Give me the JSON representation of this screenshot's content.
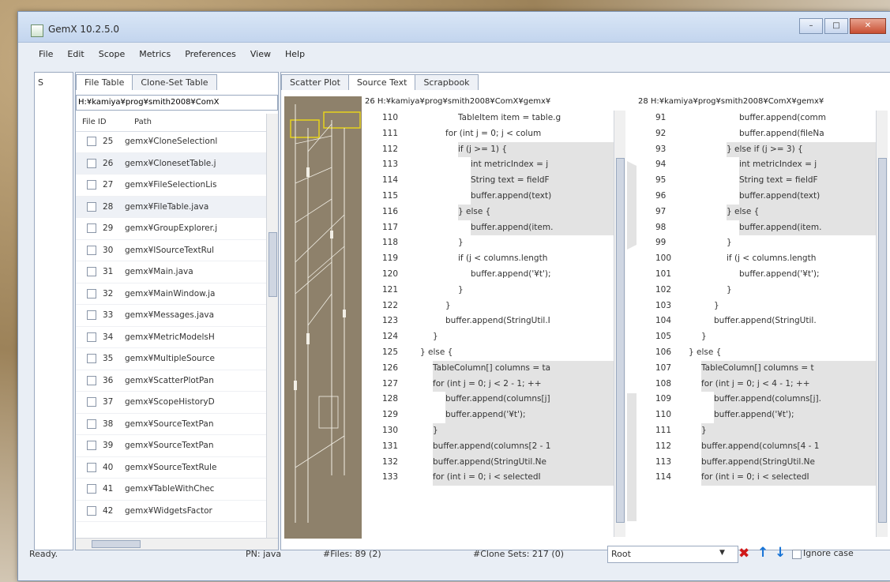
{
  "window": {
    "title": "GemX 10.2.5.0",
    "buttons": [
      "–",
      "□",
      "✕"
    ]
  },
  "menu": [
    "File",
    "Edit",
    "Scope",
    "Metrics",
    "Preferences",
    "View",
    "Help"
  ],
  "left_strip": {
    "tab": "S"
  },
  "file_panel": {
    "tabs": [
      "File Table",
      "Clone-Set Table"
    ],
    "path": "H:¥kamiya¥prog¥smith2008¥ComX",
    "columns": [
      "File ID",
      "Path"
    ],
    "rows": [
      {
        "id": "25",
        "path": "gemx¥CloneSelectionl"
      },
      {
        "id": "26",
        "path": "gemx¥ClonesetTable.j"
      },
      {
        "id": "27",
        "path": "gemx¥FileSelectionLis"
      },
      {
        "id": "28",
        "path": "gemx¥FileTable.java"
      },
      {
        "id": "29",
        "path": "gemx¥GroupExplorer.j"
      },
      {
        "id": "30",
        "path": "gemx¥ISourceTextRul"
      },
      {
        "id": "31",
        "path": "gemx¥Main.java"
      },
      {
        "id": "32",
        "path": "gemx¥MainWindow.ja"
      },
      {
        "id": "33",
        "path": "gemx¥Messages.java"
      },
      {
        "id": "34",
        "path": "gemx¥MetricModelsH"
      },
      {
        "id": "35",
        "path": "gemx¥MultipleSource"
      },
      {
        "id": "36",
        "path": "gemx¥ScatterPlotPan"
      },
      {
        "id": "37",
        "path": "gemx¥ScopeHistoryD"
      },
      {
        "id": "38",
        "path": "gemx¥SourceTextPan"
      },
      {
        "id": "39",
        "path": "gemx¥SourceTextPan"
      },
      {
        "id": "40",
        "path": "gemx¥SourceTextRule"
      },
      {
        "id": "41",
        "path": "gemx¥TableWithChec"
      },
      {
        "id": "42",
        "path": "gemx¥WidgetsFactor"
      }
    ]
  },
  "right_panel": {
    "tabs": [
      "Scatter Plot",
      "Source Text",
      "Scrapbook"
    ],
    "left_header": "26 H:¥kamiya¥prog¥smith2008¥ComX¥gemx¥",
    "right_header": "28 H:¥kamiya¥prog¥smith2008¥ComX¥gemx¥",
    "left_lines": [
      {
        "n": "110",
        "indent": 4,
        "hl": false,
        "code": "TableItem item = table.g"
      },
      {
        "n": "111",
        "indent": 3,
        "hl": false,
        "code": "for (int j = 0; j < colum"
      },
      {
        "n": "112",
        "indent": 4,
        "hl": true,
        "code": "if (j >= 1) {"
      },
      {
        "n": "113",
        "indent": 5,
        "hl": true,
        "code": "int metricIndex = j"
      },
      {
        "n": "114",
        "indent": 5,
        "hl": true,
        "code": "String text = fieldF"
      },
      {
        "n": "115",
        "indent": 5,
        "hl": true,
        "code": "buffer.append(text)"
      },
      {
        "n": "116",
        "indent": 4,
        "hl": true,
        "code": "} else {"
      },
      {
        "n": "117",
        "indent": 5,
        "hl": true,
        "code": "buffer.append(item."
      },
      {
        "n": "118",
        "indent": 4,
        "hl": false,
        "code": "}"
      },
      {
        "n": "119",
        "indent": 4,
        "hl": false,
        "code": "if (j < columns.length"
      },
      {
        "n": "120",
        "indent": 5,
        "hl": false,
        "code": "buffer.append('¥t');"
      },
      {
        "n": "121",
        "indent": 4,
        "hl": false,
        "code": "}"
      },
      {
        "n": "122",
        "indent": 3,
        "hl": false,
        "code": "}"
      },
      {
        "n": "123",
        "indent": 3,
        "hl": false,
        "code": "buffer.append(StringUtil.I"
      },
      {
        "n": "124",
        "indent": 2,
        "hl": false,
        "code": "}"
      },
      {
        "n": "125",
        "indent": 1,
        "hl": false,
        "code": "} else {"
      },
      {
        "n": "126",
        "indent": 2,
        "hl": true,
        "code": "TableColumn[] columns = ta"
      },
      {
        "n": "127",
        "indent": 2,
        "hl": true,
        "code": "for (int j = 0; j < 2 - 1; ++"
      },
      {
        "n": "128",
        "indent": 3,
        "hl": true,
        "code": "buffer.append(columns[j]"
      },
      {
        "n": "129",
        "indent": 3,
        "hl": true,
        "code": "buffer.append('¥t');"
      },
      {
        "n": "130",
        "indent": 2,
        "hl": true,
        "code": "}"
      },
      {
        "n": "131",
        "indent": 2,
        "hl": true,
        "code": "buffer.append(columns[2 - 1"
      },
      {
        "n": "132",
        "indent": 2,
        "hl": true,
        "code": "buffer.append(StringUtil.Ne"
      },
      {
        "n": "133",
        "indent": 2,
        "hl": true,
        "code": "for (int i = 0; i < selectedI"
      }
    ],
    "right_lines": [
      {
        "n": "91",
        "indent": 5,
        "hl": false,
        "code": "buffer.append(comm"
      },
      {
        "n": "92",
        "indent": 5,
        "hl": false,
        "code": "buffer.append(fileNa"
      },
      {
        "n": "93",
        "indent": 4,
        "hl": true,
        "code": "} else if (j >= 3) {"
      },
      {
        "n": "94",
        "indent": 5,
        "hl": true,
        "code": "int metricIndex = j"
      },
      {
        "n": "95",
        "indent": 5,
        "hl": true,
        "code": "String text = fieldF"
      },
      {
        "n": "96",
        "indent": 5,
        "hl": true,
        "code": "buffer.append(text)"
      },
      {
        "n": "97",
        "indent": 4,
        "hl": true,
        "code": "} else {"
      },
      {
        "n": "98",
        "indent": 5,
        "hl": true,
        "code": "buffer.append(item."
      },
      {
        "n": "99",
        "indent": 4,
        "hl": false,
        "code": "}"
      },
      {
        "n": "100",
        "indent": 4,
        "hl": false,
        "code": "if (j < columns.length"
      },
      {
        "n": "101",
        "indent": 5,
        "hl": false,
        "code": "buffer.append('¥t');"
      },
      {
        "n": "102",
        "indent": 4,
        "hl": false,
        "code": "}"
      },
      {
        "n": "103",
        "indent": 3,
        "hl": false,
        "code": "}"
      },
      {
        "n": "104",
        "indent": 3,
        "hl": false,
        "code": "buffer.append(StringUtil."
      },
      {
        "n": "105",
        "indent": 2,
        "hl": false,
        "code": "}"
      },
      {
        "n": "106",
        "indent": 1,
        "hl": false,
        "code": "} else {"
      },
      {
        "n": "107",
        "indent": 2,
        "hl": true,
        "code": "TableColumn[] columns = t"
      },
      {
        "n": "108",
        "indent": 2,
        "hl": true,
        "code": "for (int j = 0; j < 4 - 1; ++"
      },
      {
        "n": "109",
        "indent": 3,
        "hl": true,
        "code": "buffer.append(columns[j]."
      },
      {
        "n": "110",
        "indent": 3,
        "hl": true,
        "code": "buffer.append('¥t');"
      },
      {
        "n": "111",
        "indent": 2,
        "hl": true,
        "code": "}"
      },
      {
        "n": "112",
        "indent": 2,
        "hl": true,
        "code": "buffer.append(columns[4 - 1"
      },
      {
        "n": "113",
        "indent": 2,
        "hl": true,
        "code": "buffer.append(StringUtil.Ne"
      },
      {
        "n": "114",
        "indent": 2,
        "hl": true,
        "code": "for (int i = 0; i < selectedI"
      }
    ]
  },
  "status": {
    "ready": "Ready.",
    "pn": "PN: java",
    "files": "#Files: 89 (2)",
    "clone_sets": "#Clone Sets: 217 (0)",
    "find_value": "Root",
    "ignore_case": "Ignore case"
  }
}
